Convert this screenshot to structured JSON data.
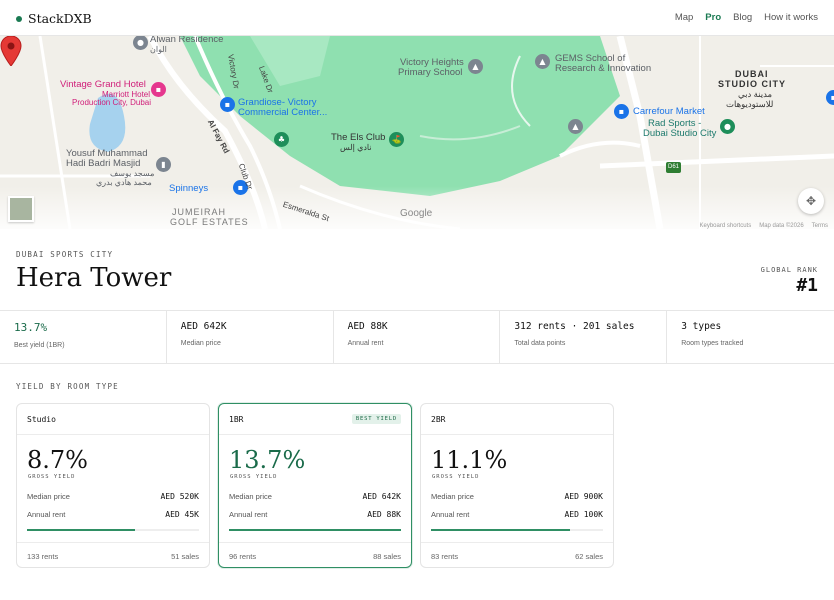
{
  "header": {
    "brand": "StackDXB",
    "nav": [
      {
        "label": "Map",
        "active": false
      },
      {
        "label": "Pro",
        "active": true
      },
      {
        "label": "Blog",
        "active": false
      },
      {
        "label": "How it works",
        "active": false
      }
    ]
  },
  "map": {
    "labels": {
      "alwan": "Alwan Residence",
      "alwan_ar": "الوان",
      "vintage": "Vintage Grand Hotel",
      "marriott1": "Marriott Hotel",
      "marriott2": "Production City, Dubai",
      "grandiose1": "Grandiose- Victory",
      "grandiose2": "Commercial Center...",
      "victory1": "Victory Heights",
      "victory2": "Primary School",
      "gems1": "GEMS School of",
      "gems2": "Research & Innovation",
      "els1": "The Els Club",
      "els_ar": "نادي إلس",
      "carrefour": "Carrefour Market",
      "radsports1": "Rad Sports -",
      "radsports2": "Dubai Studio City",
      "studio1": "DUBAI",
      "studio2": "STUDIO CITY",
      "studio_ar1": "مدينة دبي",
      "studio_ar2": "للاستوديوهات",
      "yousuf1": "Yousuf Muhammad",
      "yousuf2": "Hadi Badri Masjid",
      "yousuf_ar1": "مسجد يوسف",
      "yousuf_ar2": "محمد هادي بدري",
      "spinneys": "Spinneys",
      "jumeirah1": "JUMEIRAH",
      "jumeirah2": "GOLF ESTATES",
      "road_alfay": "Al Fay Rd",
      "road_victory": "Victory Dr",
      "road_lake": "Lake Dr",
      "road_club": "Club Dr",
      "road_esmeralda": "Esmeralda St",
      "road_d61": "D61",
      "google": "Google",
      "attrib_shortcuts": "Keyboard shortcuts",
      "attrib_data": "Map data ©2026",
      "attrib_terms": "Terms"
    },
    "colors": {
      "land": "#f1efe9",
      "park": "#8fe0b0",
      "water": "#a6d2ee",
      "road": "#ffffff",
      "marker": "#e53935"
    }
  },
  "property": {
    "area": "DUBAI SPORTS CITY",
    "name": "Hera Tower",
    "rank_label": "GLOBAL RANK",
    "rank_value": "#1"
  },
  "stats": [
    {
      "value": "13.7%",
      "label": "Best yield (1BR)",
      "accent": true
    },
    {
      "value": "AED 642K",
      "label": "Median price",
      "accent": false
    },
    {
      "value": "AED 88K",
      "label": "Annual rent",
      "accent": false
    },
    {
      "value": "312 rents · 201 sales",
      "label": "Total data points",
      "accent": false
    },
    {
      "value": "3 types",
      "label": "Room types tracked",
      "accent": false
    }
  ],
  "section_label": "YIELD BY ROOM TYPE",
  "cards": [
    {
      "type": "Studio",
      "badge": "",
      "yield": "8.7%",
      "yield_label": "GROSS YIELD",
      "price_label": "Median price",
      "price": "AED 520K",
      "rent_label": "Annual rent",
      "rent": "AED 45K",
      "fill": 0.63,
      "rents": "133 rents",
      "sales": "51 sales",
      "highlight": false
    },
    {
      "type": "1BR",
      "badge": "BEST YIELD",
      "yield": "13.7%",
      "yield_label": "GROSS YIELD",
      "price_label": "Median price",
      "price": "AED 642K",
      "rent_label": "Annual rent",
      "rent": "AED 88K",
      "fill": 1.0,
      "rents": "96 rents",
      "sales": "88 sales",
      "highlight": true
    },
    {
      "type": "2BR",
      "badge": "",
      "yield": "11.1%",
      "yield_label": "GROSS YIELD",
      "price_label": "Median price",
      "price": "AED 900K",
      "rent_label": "Annual rent",
      "rent": "AED 100K",
      "fill": 0.81,
      "rents": "83 rents",
      "sales": "62 sales",
      "highlight": false
    }
  ]
}
